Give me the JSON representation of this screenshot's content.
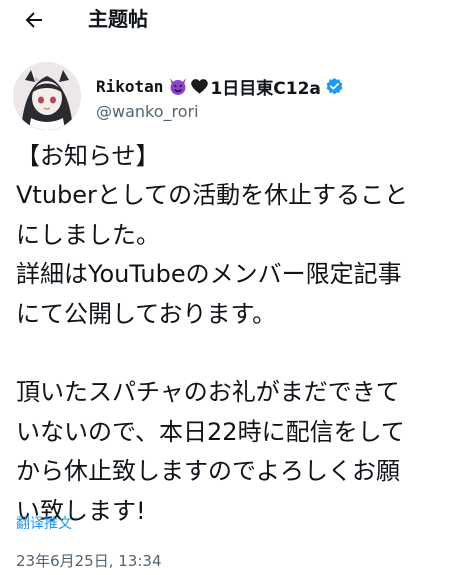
{
  "header": {
    "title": "主题帖",
    "back_icon": "arrow-left-icon"
  },
  "author": {
    "display_name": "Rikotan",
    "emojis": [
      "smiling-devil-icon",
      "black-heart-icon"
    ],
    "name_suffix": "1日目東C12a",
    "verified_icon": "verified-badge-icon",
    "handle": "@wanko_rori",
    "avatar_icon": "avatar"
  },
  "tweet": {
    "lines": [
      "【お知らせ】",
      "Vtuberとしての活動を休止すること",
      "にしました。",
      "詳細はYouTubeのメンバー限定記事",
      "にて公開しております。",
      "",
      "頂いたスパチャのお礼がまだできて",
      "いないので、本日22時に配信をして",
      "から休止致しますのでよろしくお願",
      "い致します!"
    ]
  },
  "translate_label": "翻译推文",
  "timestamp": "23年6月25日, 13:34",
  "colors": {
    "text": "#0f1419",
    "secondary": "#536471",
    "link": "#1d9bf0",
    "verified": "#1d9bf0"
  }
}
